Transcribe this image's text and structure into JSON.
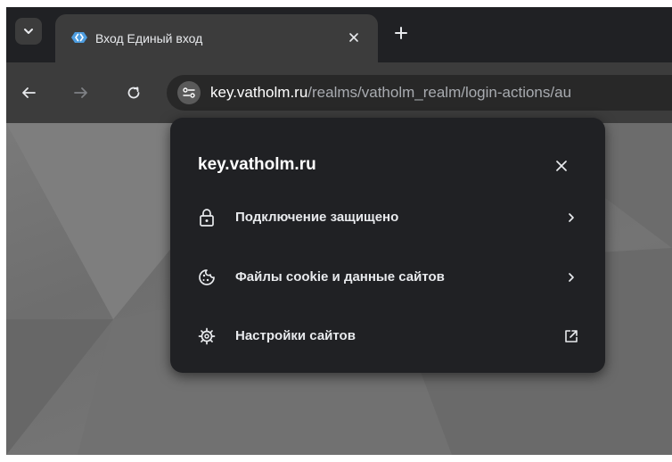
{
  "tab": {
    "title": "Вход Единый вход",
    "favicon": "keycloak-logo-icon",
    "close_icon": "close-icon"
  },
  "toolbar": {
    "url_host": "key.vatholm.ru",
    "url_path": "/realms/vatholm_realm/login-actions/au"
  },
  "popup": {
    "title": "key.vatholm.ru",
    "items": [
      {
        "label": "Подключение защищено",
        "icon": "lock-icon",
        "trail": "chevron-right-icon"
      },
      {
        "label": "Файлы cookie и данные сайтов",
        "icon": "cookie-icon",
        "trail": "chevron-right-icon"
      },
      {
        "label": "Настройки сайтов",
        "icon": "gear-icon",
        "trail": "open-external-icon"
      }
    ]
  },
  "colors": {
    "tab_strip": "#202124",
    "toolbar": "#3c3c3c",
    "popup": "#202124",
    "text": "#e8eaed"
  }
}
